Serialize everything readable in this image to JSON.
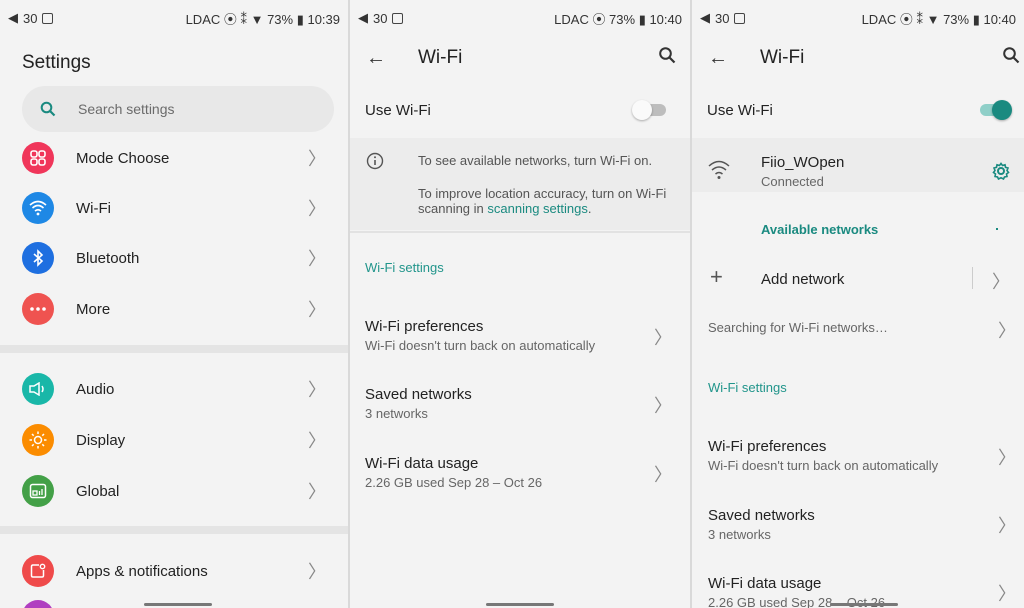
{
  "panel1": {
    "status": {
      "left": "30",
      "right": "LDAC ⦿ ⁑ ▼ 73% ▮ 10:39"
    },
    "title": "Settings",
    "search_placeholder": "Search settings",
    "items": [
      {
        "label": "Mode Choose",
        "icon": "apps-grid-icon",
        "color": "#f0365a"
      },
      {
        "label": "Wi-Fi",
        "icon": "wifi-icon",
        "color": "#1e88e5"
      },
      {
        "label": "Bluetooth",
        "icon": "bluetooth-icon",
        "color": "#1e6fe0"
      },
      {
        "label": "More",
        "icon": "more-dots-icon",
        "color": "#ef5350"
      },
      {
        "label": "Audio",
        "icon": "audio-icon",
        "color": "#19b7a8"
      },
      {
        "label": "Display",
        "icon": "brightness-icon",
        "color": "#fb8c00"
      },
      {
        "label": "Global",
        "icon": "global-icon",
        "color": "#43a047"
      },
      {
        "label": "Apps & notifications",
        "icon": "apps-notifications-icon",
        "color": "#ef4a4a"
      }
    ]
  },
  "panel2": {
    "status": {
      "left": "30",
      "right": "LDAC ⦿ 73% ▮ 10:40"
    },
    "title": "Wi-Fi",
    "use_wifi": "Use Wi-Fi",
    "info1": "To see available networks, turn Wi-Fi on.",
    "info2_prefix": "To improve location accuracy, turn on Wi-Fi scanning in",
    "info2_link": "scanning settings",
    "info2_suffix": ".",
    "section": "Wi-Fi settings",
    "prefs": [
      {
        "title": "Wi-Fi preferences",
        "sub": "Wi-Fi doesn't turn back on automatically"
      },
      {
        "title": "Saved networks",
        "sub": "3 networks"
      },
      {
        "title": "Wi-Fi data usage",
        "sub": "2.26 GB used Sep 28 – Oct 26"
      }
    ]
  },
  "panel3": {
    "status": {
      "left": "30",
      "right": "LDAC ⦿ ⁑ ▼ 73% ▮ 10:40"
    },
    "title": "Wi-Fi",
    "use_wifi": "Use Wi-Fi",
    "network_name": "Fiio_WOpen",
    "network_status": "Connected",
    "available": "Available networks",
    "add_network": "Add network",
    "searching": "Searching for Wi-Fi networks…",
    "section": "Wi-Fi settings",
    "prefs": [
      {
        "title": "Wi-Fi preferences",
        "sub": "Wi-Fi doesn't turn back on automatically"
      },
      {
        "title": "Saved networks",
        "sub": "3 networks"
      },
      {
        "title": "Wi-Fi data usage",
        "sub": "2.26 GB used Sep 28 – Oct 26"
      }
    ]
  },
  "colors": {
    "accent": "#1a8a80",
    "toggle_on": "#1a8a80"
  }
}
